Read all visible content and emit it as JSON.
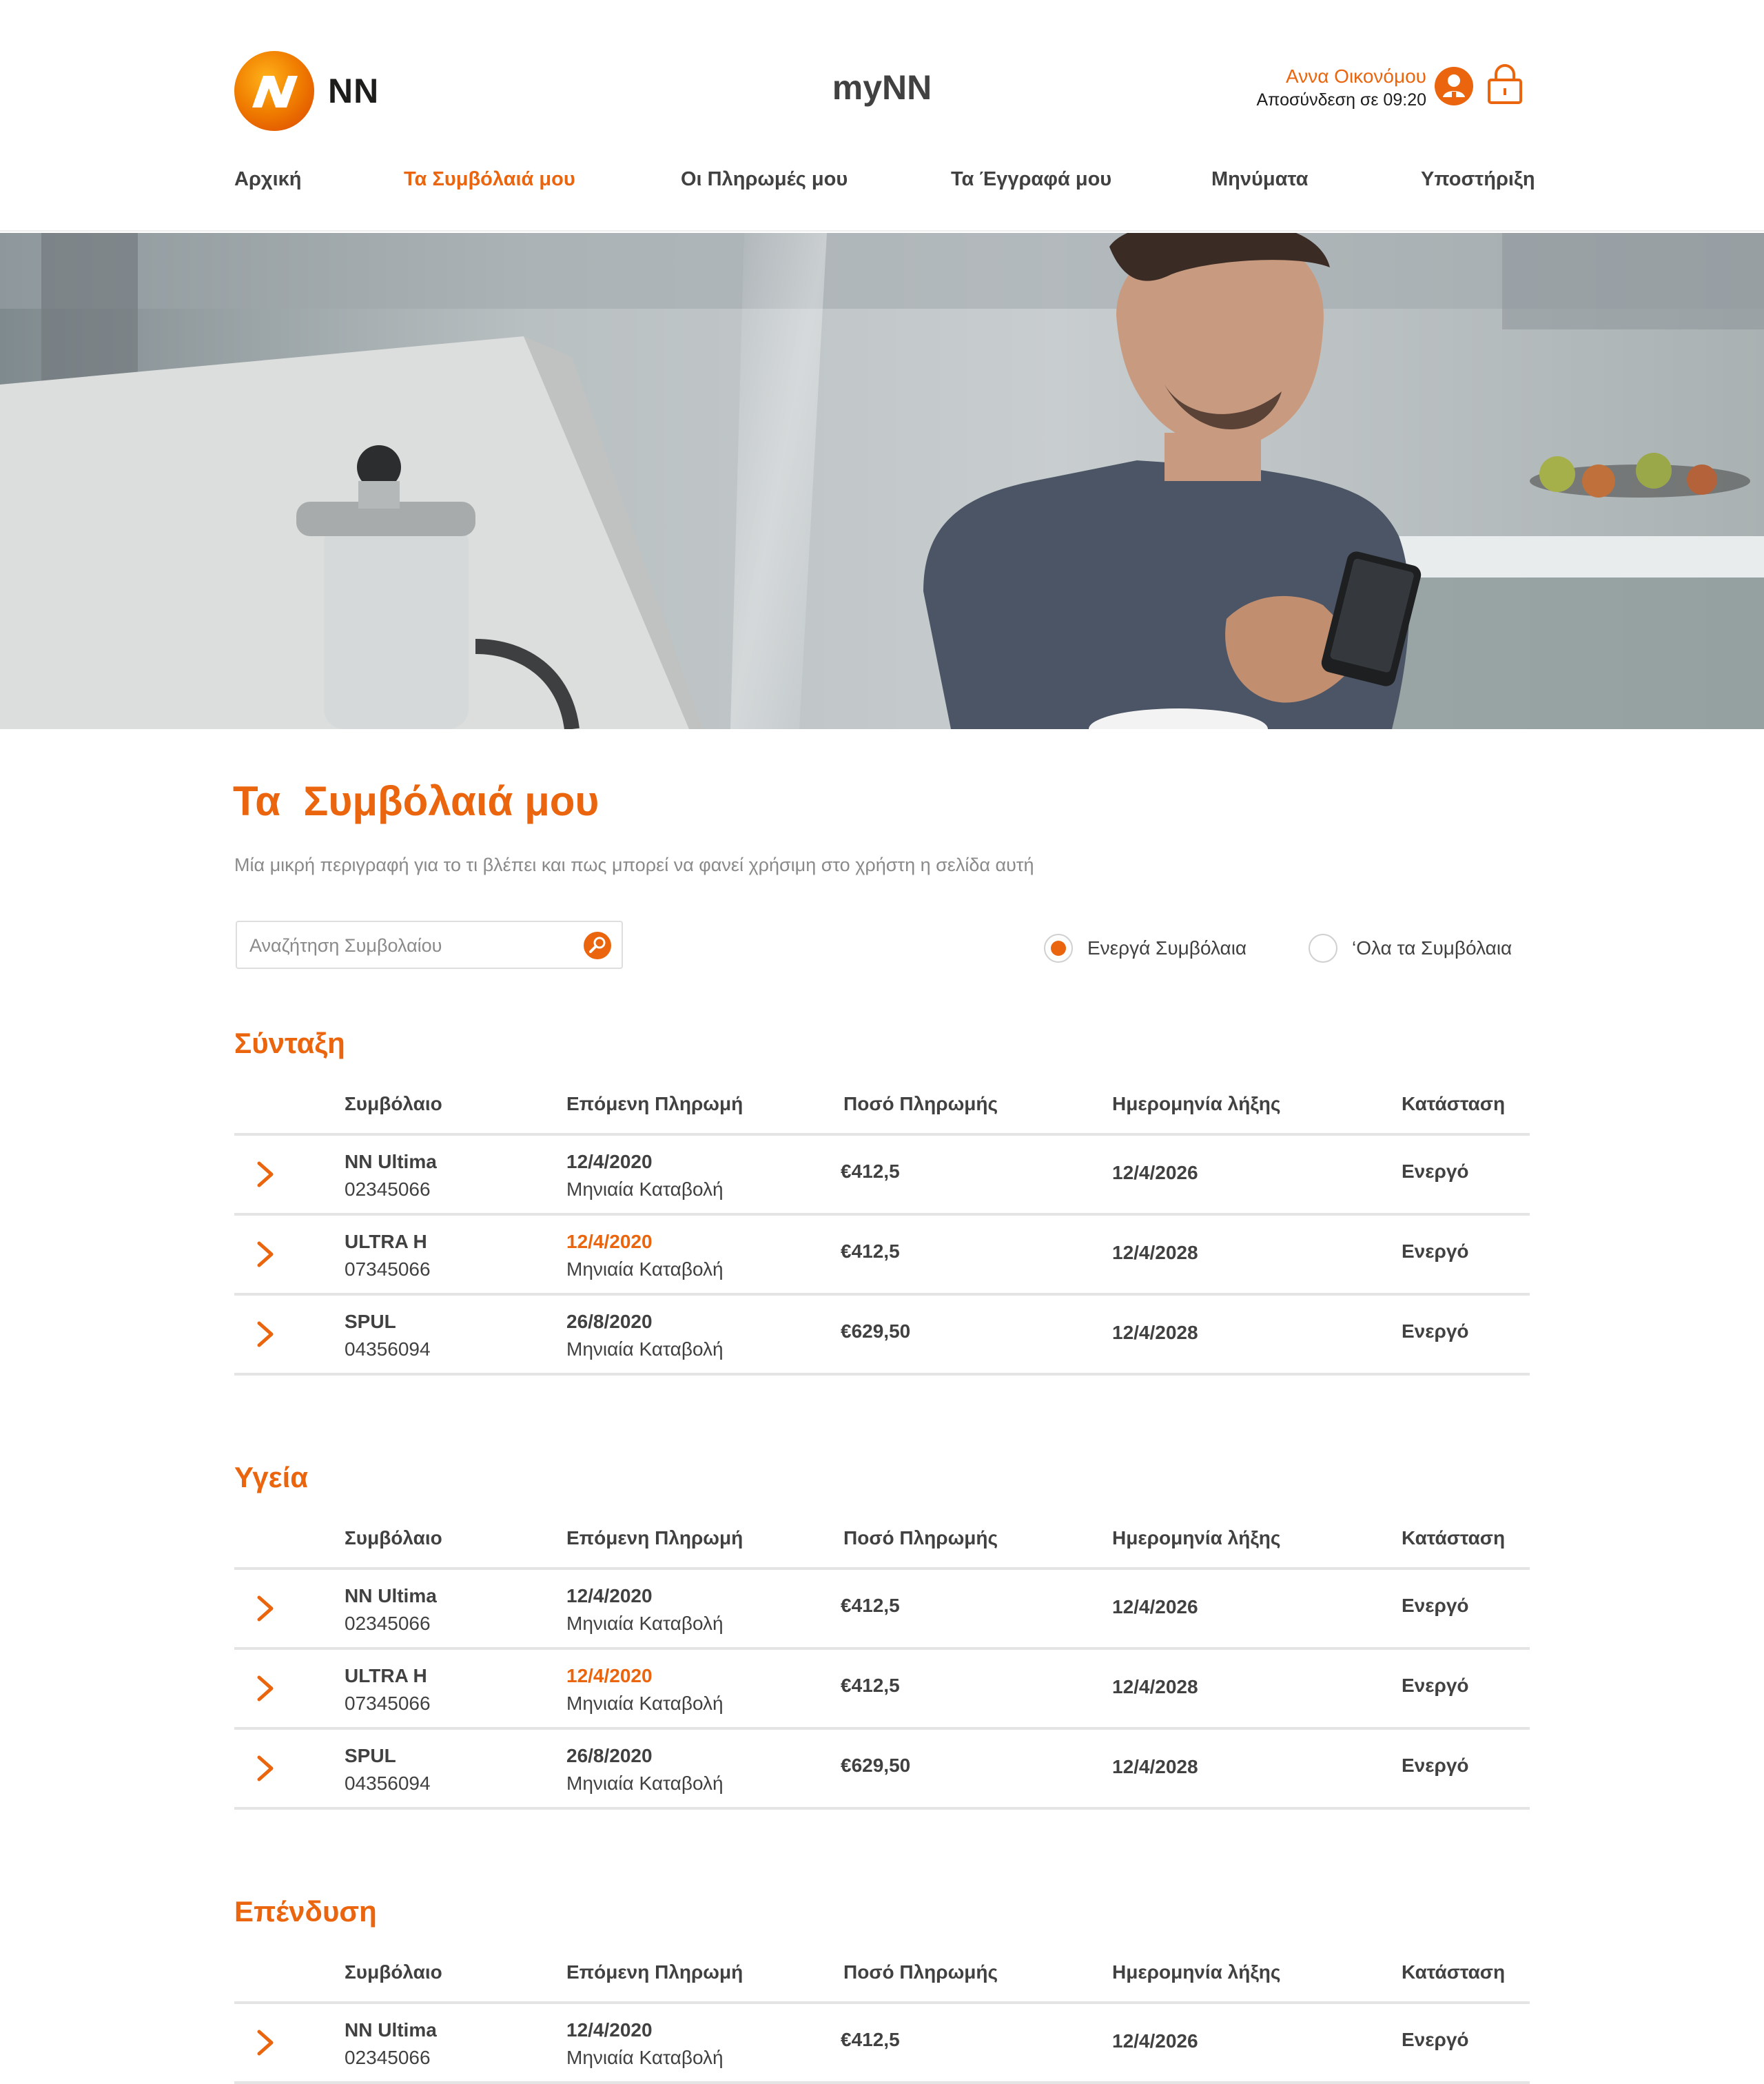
{
  "brand": {
    "logo_text": "NN",
    "app_title": "myNN",
    "accent": "#ea650d"
  },
  "user": {
    "name": "Αννα Οικονόμου",
    "logout_text": "Αποσύνδεση σε 09:20"
  },
  "nav": [
    {
      "label": "Αρχική",
      "active": false
    },
    {
      "label": "Τα Συμβόλαιά μου",
      "active": true
    },
    {
      "label": "Οι Πληρωμές μου",
      "active": false
    },
    {
      "label": "Τα Έγγραφά μου",
      "active": false
    },
    {
      "label": "Μηνύματα",
      "active": false
    },
    {
      "label": "Υποστήριξη",
      "active": false
    }
  ],
  "page": {
    "title": "Τα  Συμβόλαιά μου",
    "description": "Μία μικρή περιγραφή για το τι βλέπει και πως μπορεί να φανεί χρήσιμη στο χρήστη η σελίδα αυτή"
  },
  "search": {
    "placeholder": "Αναζήτηση Συμβολαίου",
    "value": ""
  },
  "filters": [
    {
      "label": "Ενεργά Συμβόλαια",
      "selected": true
    },
    {
      "label": "‘Ολα τα Συμβόλαια",
      "selected": false
    }
  ],
  "columns": [
    "Συμβόλαιο",
    "Επόμενη Πληρωμή",
    "Ποσό Πληρωμής",
    "Ημερομηνία λήξης",
    "Κατάσταση"
  ],
  "sections": [
    {
      "title": "Σύνταξη",
      "rows": [
        {
          "product": "NN Ultima",
          "number": "02345066",
          "next_date": "12/4/2020",
          "next_date_alert": false,
          "frequency": "Μηνιαία Καταβολή",
          "amount": "€412,5",
          "expiry": "12/4/2026",
          "status": "Ενεργό"
        },
        {
          "product": "ULTRA H",
          "number": "07345066",
          "next_date": "12/4/2020",
          "next_date_alert": true,
          "frequency": "Μηνιαία Καταβολή",
          "amount": "€412,5",
          "expiry": "12/4/2028",
          "status": "Ενεργό"
        },
        {
          "product": "SPUL",
          "number": "04356094",
          "next_date": "26/8/2020",
          "next_date_alert": false,
          "frequency": "Μηνιαία Καταβολή",
          "amount": "€629,50",
          "expiry": "12/4/2028",
          "status": "Ενεργό"
        }
      ]
    },
    {
      "title": "Υγεία",
      "rows": [
        {
          "product": "NN Ultima",
          "number": "02345066",
          "next_date": "12/4/2020",
          "next_date_alert": false,
          "frequency": "Μηνιαία Καταβολή",
          "amount": "€412,5",
          "expiry": "12/4/2026",
          "status": "Ενεργό"
        },
        {
          "product": "ULTRA H",
          "number": "07345066",
          "next_date": "12/4/2020",
          "next_date_alert": true,
          "frequency": "Μηνιαία Καταβολή",
          "amount": "€412,5",
          "expiry": "12/4/2028",
          "status": "Ενεργό"
        },
        {
          "product": "SPUL",
          "number": "04356094",
          "next_date": "26/8/2020",
          "next_date_alert": false,
          "frequency": "Μηνιαία Καταβολή",
          "amount": "€629,50",
          "expiry": "12/4/2028",
          "status": "Ενεργό"
        }
      ]
    },
    {
      "title": "Επένδυση",
      "rows": [
        {
          "product": "NN Ultima",
          "number": "02345066",
          "next_date": "12/4/2020",
          "next_date_alert": false,
          "frequency": "Μηνιαία Καταβολή",
          "amount": "€412,5",
          "expiry": "12/4/2026",
          "status": "Ενεργό"
        }
      ]
    }
  ]
}
